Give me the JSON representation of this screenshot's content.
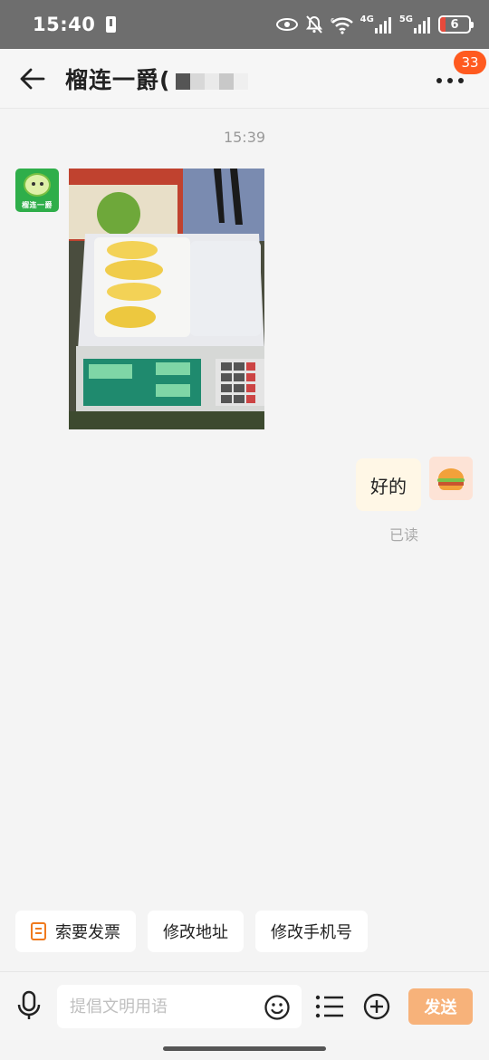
{
  "status_bar": {
    "time": "15:40",
    "network_4g": "4G",
    "network_5g": "5G",
    "wifi_label": "6",
    "battery": "6",
    "icons": [
      "alert-icon",
      "eye-icon",
      "bell-off-icon",
      "wifi-icon",
      "signal-icon",
      "battery-icon"
    ]
  },
  "header": {
    "title": "榴连一爵(",
    "badge_count": "33"
  },
  "chat": {
    "timestamp": "15:39",
    "sender_brand": "榴连一爵",
    "messages": [
      {
        "side": "left",
        "type": "image",
        "image": "durian-on-scale-photo"
      },
      {
        "side": "right",
        "type": "text",
        "text": "好的",
        "status": "已读"
      }
    ]
  },
  "quick_actions": [
    {
      "label": "索要发票",
      "icon": "invoice-icon"
    },
    {
      "label": "修改地址"
    },
    {
      "label": "修改手机号"
    }
  ],
  "input": {
    "placeholder": "提倡文明用语",
    "value": "",
    "send_label": "发送"
  },
  "colors": {
    "accent": "#ff5a1f",
    "send_button": "#f7b27a",
    "bubble_right": "#fff7e6",
    "status_bar": "#6e6e6e"
  }
}
